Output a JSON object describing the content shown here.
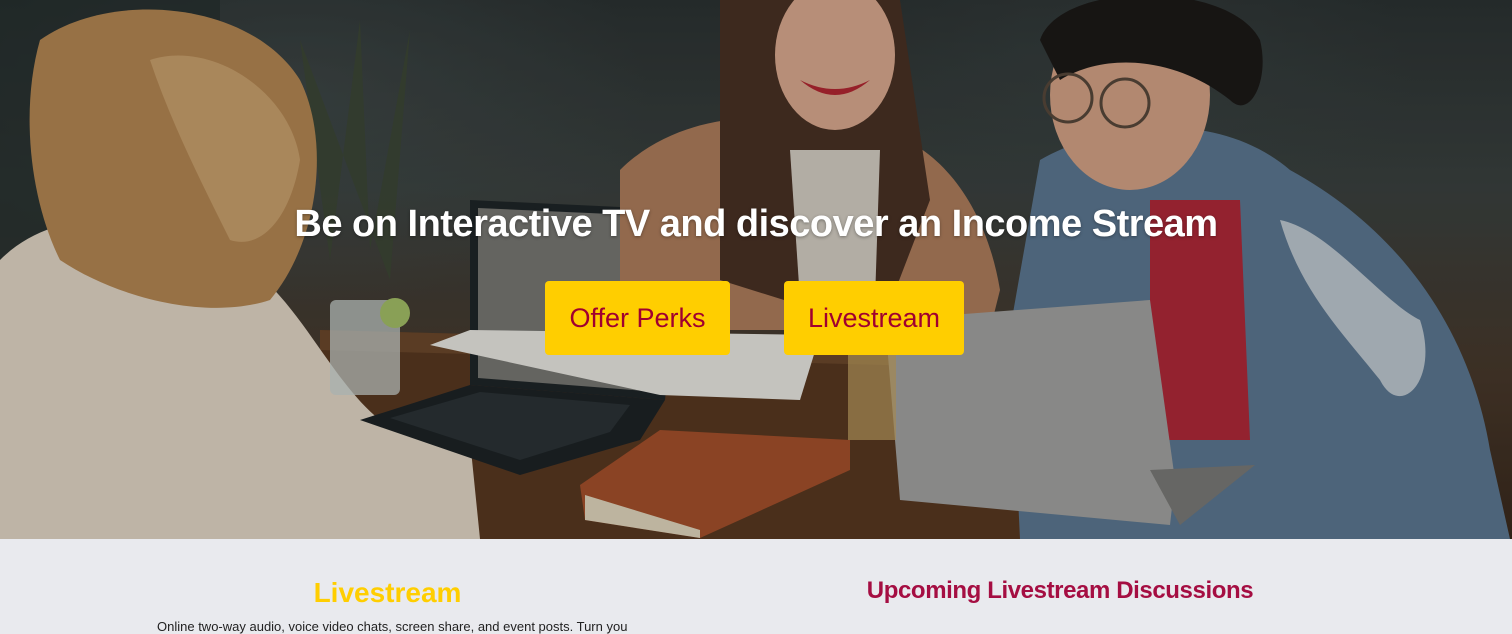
{
  "hero": {
    "title": "Be on Interactive TV and discover an Income Stream",
    "buttons": {
      "offer_perks": "Offer Perks",
      "livestream": "Livestream"
    },
    "image_description": "three-people-laughing-at-laptops"
  },
  "livestream_section": {
    "heading": "Livestream",
    "text": "Online two-way audio, voice video chats, screen share, and event posts. Turn your"
  },
  "upcoming_section": {
    "heading": "Upcoming Livestream Discussions"
  },
  "colors": {
    "accent_yellow": "#ffce00",
    "button_text": "#a00030",
    "upcoming_heading": "#a50e42",
    "section_bg": "#e9eaee"
  }
}
